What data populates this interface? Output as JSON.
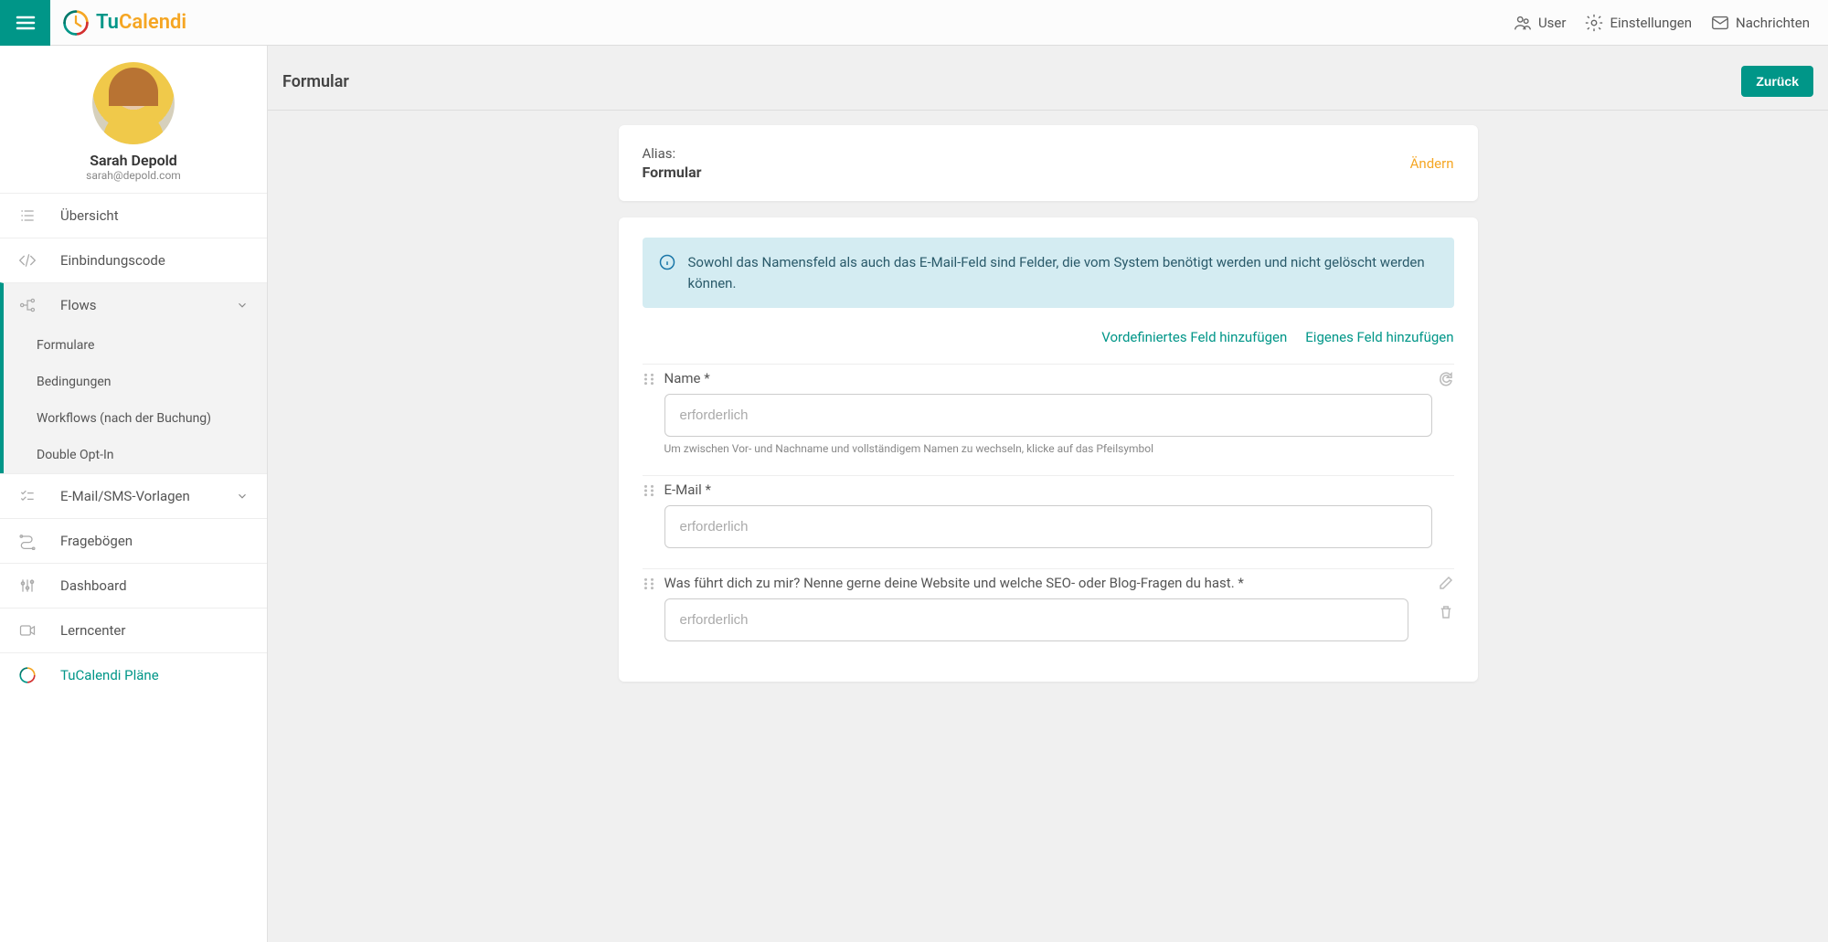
{
  "header": {
    "logo_tu": "Tu",
    "logo_calendi": "Calendi",
    "actions": {
      "user": "User",
      "settings": "Einstellungen",
      "messages": "Nachrichten"
    }
  },
  "profile": {
    "name": "Sarah Depold",
    "email": "sarah@depold.com"
  },
  "sidebar": {
    "overview": "Übersicht",
    "embed": "Einbindungscode",
    "flows": "Flows",
    "flows_sub": {
      "forms": "Formulare",
      "conditions": "Bedingungen",
      "workflows": "Workflows (nach der Buchung)",
      "doubleoptin": "Double Opt-In"
    },
    "templates": "E-Mail/SMS-Vorlagen",
    "surveys": "Fragebögen",
    "dashboard": "Dashboard",
    "learn": "Lerncenter",
    "plans": "TuCalendi Pläne"
  },
  "page": {
    "title": "Formular",
    "back_btn": "Zurück"
  },
  "alias_card": {
    "label": "Alias:",
    "value": "Formular",
    "change": "Ändern"
  },
  "info_banner": "Sowohl das Namensfeld als auch das E-Mail-Feld sind Felder, die vom System benötigt werden und nicht gelöscht werden können.",
  "actions": {
    "add_predefined": "Vordefiniertes Feld hinzufügen",
    "add_custom": "Eigenes Feld hinzufügen"
  },
  "fields": [
    {
      "label": "Name *",
      "placeholder": "erforderlich",
      "hint": "Um zwischen Vor- und Nachname und vollständigem Namen zu wechseln, klicke auf das Pfeilsymbol",
      "side_icons": [
        "refresh"
      ]
    },
    {
      "label": "E-Mail *",
      "placeholder": "erforderlich",
      "hint": "",
      "side_icons": []
    },
    {
      "label": "Was führt dich zu mir? Nenne gerne deine Website und welche SEO- oder Blog-Fragen du hast. *",
      "placeholder": "erforderlich",
      "hint": "",
      "side_icons": [
        "edit",
        "delete"
      ]
    }
  ]
}
